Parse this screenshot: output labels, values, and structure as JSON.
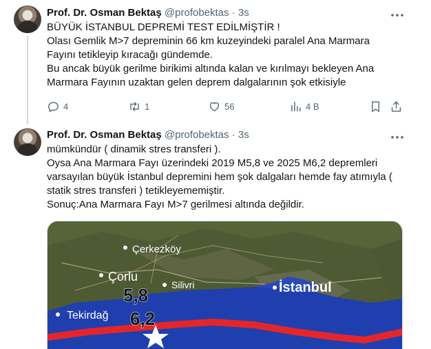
{
  "tweets": [
    {
      "author_name": "Prof. Dr. Osman Bektaş",
      "handle": "@profobektas",
      "separator": "·",
      "time": "3s",
      "more_icon": "more-icon",
      "lines": [
        "BÜYÜK İSTANBUL DEPREMİ TEST EDİLMİŞTİR !",
        "Olası Gemlik M>7 depreminin 66 km kuzeyindeki paralel Ana Marmara",
        "Fayını tetikleyip kıracağı gündemde.",
        "Bu ancak büyük gerilme birikimi altında kalan ve kırılmayı bekleyen Ana",
        "Marmara Fayının uzaktan gelen deprem dalgalarının şok etkisiyle"
      ],
      "actions": {
        "reply_count": "4",
        "retweet_count": "1",
        "like_count": "56",
        "views_count": "4 B"
      }
    },
    {
      "author_name": "Prof. Dr. Osman Bektaş",
      "handle": "@profobektas",
      "separator": "·",
      "time": "3s",
      "more_icon": "more-icon",
      "lines": [
        "mümkündür ( dinamik stres transferi ).",
        "Oysa Ana Marmara Fayı üzerindeki 2019 M5,8 ve 2025 M6,2 depremleri",
        "varsayılan büyük İstanbul depremini hem şok dalgaları hemde fay atımıyla (",
        "statik stres transferi ) tetikleyememiştir.",
        "Sonuç:Ana Marmara Fayı M>7 gerilmesi altında değildir."
      ],
      "map": {
        "labels": {
          "cerkezkoy": "Çerkezköy",
          "corlu": "Çorlu",
          "silivri": "Silivri",
          "istanbul": "İstanbul",
          "tekirdag": "Tekirdağ",
          "mag1": "5,8",
          "mag2": "6,2"
        }
      }
    }
  ],
  "colors": {
    "text": "#0f1419",
    "muted": "#536471",
    "border": "#cfd9de",
    "fault_red": "#e3262b",
    "sea": "#1f3fae"
  }
}
